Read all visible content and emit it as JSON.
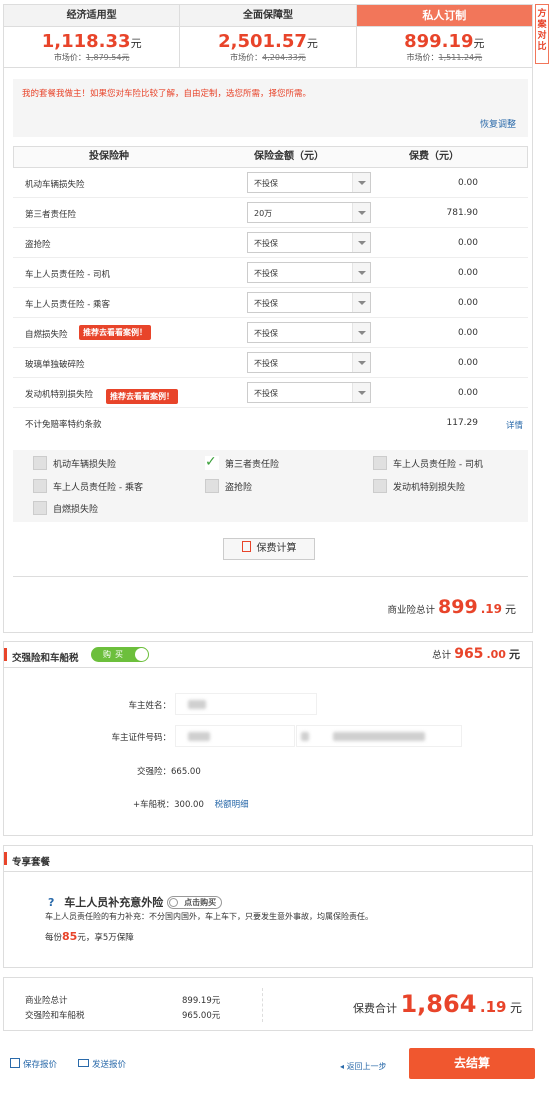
{
  "plans": [
    {
      "name": "经济适用型",
      "price": "1,118.33",
      "unit": "元",
      "market_label": "市场价：",
      "market_price": "1,879.54元",
      "active": false
    },
    {
      "name": "全面保障型",
      "price": "2,501.57",
      "unit": "元",
      "market_label": "市场价：",
      "market_price": "4,204.33元",
      "active": false
    },
    {
      "name": "私人订制",
      "price": "899.19",
      "unit": "元",
      "market_label": "市场价：",
      "market_price": "1,511.24元",
      "active": true
    }
  ],
  "compare_label": "方案对比",
  "notice": {
    "text": "我的套餐我做主！如果您对车险比较了解，自由定制，选您所需，择您所需。",
    "restore": "恢复调整"
  },
  "table": {
    "headers": [
      "投保险种",
      "保险金额（元）",
      "保费（元）"
    ],
    "rows": [
      {
        "name": "机动车辆损失险",
        "value": "不投保",
        "fee": "0.00"
      },
      {
        "name": "第三者责任险",
        "value": "20万",
        "fee": "781.90"
      },
      {
        "name": "盗抢险",
        "value": "不投保",
        "fee": "0.00"
      },
      {
        "name": "车上人员责任险 - 司机",
        "value": "不投保",
        "fee": "0.00"
      },
      {
        "name": "车上人员责任险 - 乘客",
        "value": "不投保",
        "fee": "0.00"
      },
      {
        "name": "自燃损失险",
        "value": "不投保",
        "fee": "0.00",
        "tag": "推荐去看看案例！"
      },
      {
        "name": "玻璃单独破碎险",
        "value": "不投保",
        "fee": "0.00"
      },
      {
        "name": "发动机特别损失险",
        "value": "不投保",
        "fee": "0.00",
        "tag": "推荐去看看案例！"
      }
    ],
    "deductible": {
      "name": "不计免赔率特约条款",
      "fee": "117.29",
      "detail": "详情"
    }
  },
  "checks": [
    {
      "label": "机动车辆损失险",
      "checked": false
    },
    {
      "label": "第三者责任险",
      "checked": true
    },
    {
      "label": "车上人员责任险 - 司机",
      "checked": false
    },
    {
      "label": "车上人员责任险 - 乘客",
      "checked": false
    },
    {
      "label": "盗抢险",
      "checked": false
    },
    {
      "label": "发动机特别损失险",
      "checked": false
    },
    {
      "label": "自燃损失险",
      "checked": false
    }
  ],
  "calc_button": "保费计算",
  "commercial_total": {
    "label": "商业险总计",
    "int": "899",
    "dec": ".19",
    "unit": "元"
  },
  "compulsory": {
    "title": "交强险和车船税",
    "toggle": "购买",
    "total_label": "总计",
    "total_int": "965",
    "total_dec": ".00",
    "unit": "元",
    "owner_name_label": "车主姓名：",
    "owner_id_label": "车主证件号码：",
    "compulsory_line": "交强险：665.00",
    "tax_line": "+车船税：300.00",
    "tax_link": "税额明细"
  },
  "exclusive": {
    "title": "专享套餐",
    "product": "车上人员补充意外险",
    "buy_pill": "点击购买",
    "desc": "车上人员责任险的有力补充：不分国内国外，车上车下，只要发生意外事故，均属保险责任。",
    "price_pre": "每份",
    "price": "85",
    "price_post": "元，享5万保障"
  },
  "summary": {
    "l1": "商业险总计",
    "v1": "899.19元",
    "l2": "交强险和车船税",
    "v2": "965.00元",
    "total_label": "保费合计",
    "total_int": "1,864",
    "total_dec": ".19",
    "unit": "元"
  },
  "footer": {
    "save": "保存报价",
    "send": "发送报价",
    "back": "返回上一步",
    "checkout": "去结算"
  },
  "colors": {
    "accent": "#e8442a",
    "active_tab": "#f2765a",
    "toggle_green": "#6cbf3c",
    "link": "#2a6aaa"
  }
}
